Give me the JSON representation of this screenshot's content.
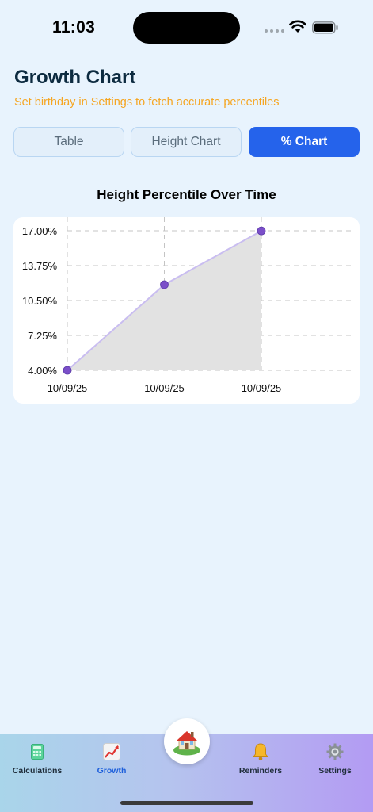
{
  "status_bar": {
    "time": "11:03"
  },
  "header": {
    "title": "Growth Chart",
    "subtitle": "Set birthday in Settings to fetch accurate percentiles"
  },
  "segments": [
    {
      "label": "Table",
      "active": false
    },
    {
      "label": "Height Chart",
      "active": false
    },
    {
      "label": "% Chart",
      "active": true
    }
  ],
  "colors": {
    "accent": "#2563eb",
    "warning_text": "#f5a623",
    "point": "#7b4fc9",
    "line": "#c9bdf0",
    "area": "#e2e2e2"
  },
  "chart_data": {
    "type": "area",
    "title": "Height Percentile Over Time",
    "x": [
      "10/09/25",
      "10/09/25",
      "10/09/25"
    ],
    "series": [
      {
        "values": [
          4.0,
          11.98,
          16.99
        ]
      }
    ],
    "yticks": [
      "17.00%",
      "13.75%",
      "10.50%",
      "7.25%",
      "4.00%"
    ],
    "ylim": [
      4.0,
      17.0
    ],
    "grid": true,
    "grid_style": "dashed",
    "xlabel": "",
    "ylabel": ""
  },
  "tab_bar": {
    "items": [
      {
        "label": "Calculations",
        "icon": "calculator-icon"
      },
      {
        "label": "Growth",
        "icon": "chart-increasing-icon",
        "active": true
      },
      {
        "label": "Reminders",
        "icon": "bell-icon"
      },
      {
        "label": "Settings",
        "icon": "gear-icon"
      }
    ],
    "center_icon": "house-icon"
  }
}
